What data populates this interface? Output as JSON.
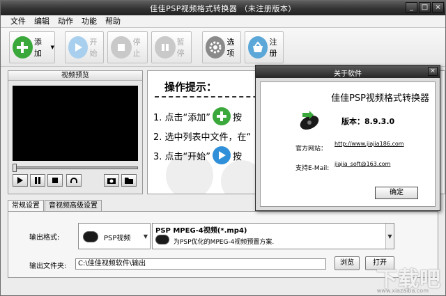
{
  "app": {
    "title": "佳佳PSP视频格式转换器 （未注册版本）"
  },
  "titlebar_buttons": {
    "min": "_",
    "max": "□",
    "close": "×"
  },
  "menu": [
    "文件",
    "编辑",
    "动作",
    "功能",
    "帮助"
  ],
  "toolbar": {
    "add": "添加",
    "start": "开始",
    "stop": "停止",
    "pause": "暂停",
    "options": "选项",
    "register": "注册"
  },
  "preview": {
    "header": "视频预览"
  },
  "tips": {
    "title": "操作提示：",
    "step1": "1. 点击“添加”",
    "step1_tail": "按",
    "step2": "2. 选中列表中文件，在“",
    "step3": "3. 点击“开始”",
    "step3_tail": "按"
  },
  "tabs": {
    "general": "常规设置",
    "advanced": "音视频高级设置"
  },
  "settings": {
    "output_format_label": "输出格式:",
    "format_device": "PSP视频",
    "format_profile": "PSP MPEG-4视频(*.mp4)",
    "format_desc": "为PSP优化的MPEG-4视频预置方案.",
    "output_folder_label": "输出文件夹:",
    "output_folder_value": "C:\\佳佳视频软件\\输出",
    "browse": "浏览",
    "open": "打开"
  },
  "about": {
    "title": "关于软件",
    "app_name": "佳佳PSP视频格式转换器",
    "version": "版本：8.9.3.0",
    "website_label": "官方网站：",
    "website": "http://www.jiajia186.com",
    "email_label": "支持E-Mail:",
    "email": "jiajia_soft@163.com",
    "ok": "确定",
    "close": "×"
  },
  "watermark": {
    "brand": "下载吧",
    "url": "www.xiazaiba.com"
  },
  "colors": {
    "green": "#3aa83a",
    "blue": "#2f8fd8",
    "disabled": "#c9c9c9"
  }
}
